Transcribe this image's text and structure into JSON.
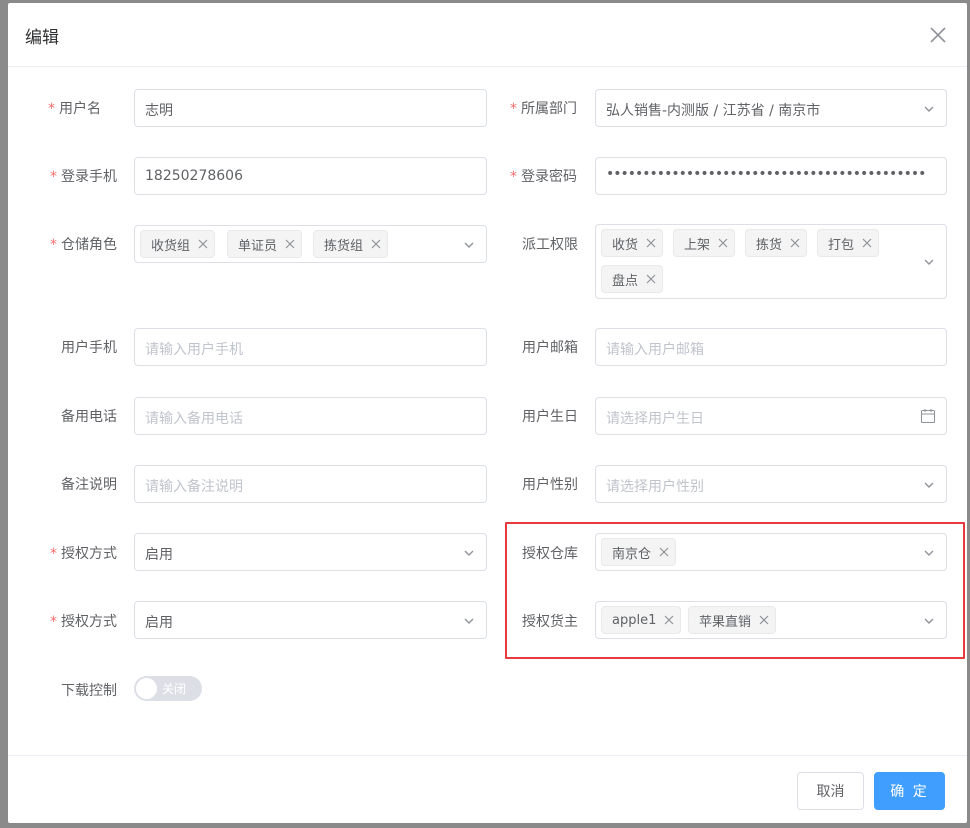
{
  "dialog": {
    "title": "编辑"
  },
  "form": {
    "username": {
      "label": "用户名",
      "value": "志明"
    },
    "department": {
      "label": "所属部门",
      "value": "弘人销售-内测版 / 江苏省 / 南京市"
    },
    "login_phone": {
      "label": "登录手机",
      "value": "18250278606"
    },
    "login_password": {
      "label": "登录密码",
      "value": "••••••••••••••••••••••••••••••••••••••••••••"
    },
    "warehouse_role": {
      "label": "仓储角色",
      "tags": [
        "收货组",
        "单证员",
        "拣货组"
      ]
    },
    "dispatch_perm": {
      "label": "派工权限",
      "tags": [
        "收货",
        "上架",
        "拣货",
        "打包",
        "盘点"
      ]
    },
    "user_phone": {
      "label": "用户手机",
      "placeholder": "请输入用户手机"
    },
    "user_email": {
      "label": "用户邮箱",
      "placeholder": "请输入用户邮箱"
    },
    "backup_phone": {
      "label": "备用电话",
      "placeholder": "请输入备用电话"
    },
    "user_birthday": {
      "label": "用户生日",
      "placeholder": "请选择用户生日"
    },
    "remark": {
      "label": "备注说明",
      "placeholder": "请输入备注说明"
    },
    "user_gender": {
      "label": "用户性别",
      "placeholder": "请选择用户性别"
    },
    "auth_mode_1": {
      "label": "授权方式",
      "value": "启用"
    },
    "auth_warehouse": {
      "label": "授权仓库",
      "tags": [
        "南京仓"
      ]
    },
    "auth_mode_2": {
      "label": "授权方式",
      "value": "启用"
    },
    "auth_owner": {
      "label": "授权货主",
      "tags": [
        "apple1",
        "苹果直销"
      ]
    },
    "download_ctrl": {
      "label": "下载控制",
      "switch_text": "关闭",
      "on": false
    }
  },
  "footer": {
    "cancel_label": "取消",
    "ok_label": "确 定"
  },
  "colors": {
    "primary": "#409eff",
    "required": "#f56c6c",
    "highlight": "#e8393f"
  },
  "icons": [
    "close-icon",
    "chevron-down-icon",
    "calendar-icon",
    "tag-close-icon"
  ]
}
